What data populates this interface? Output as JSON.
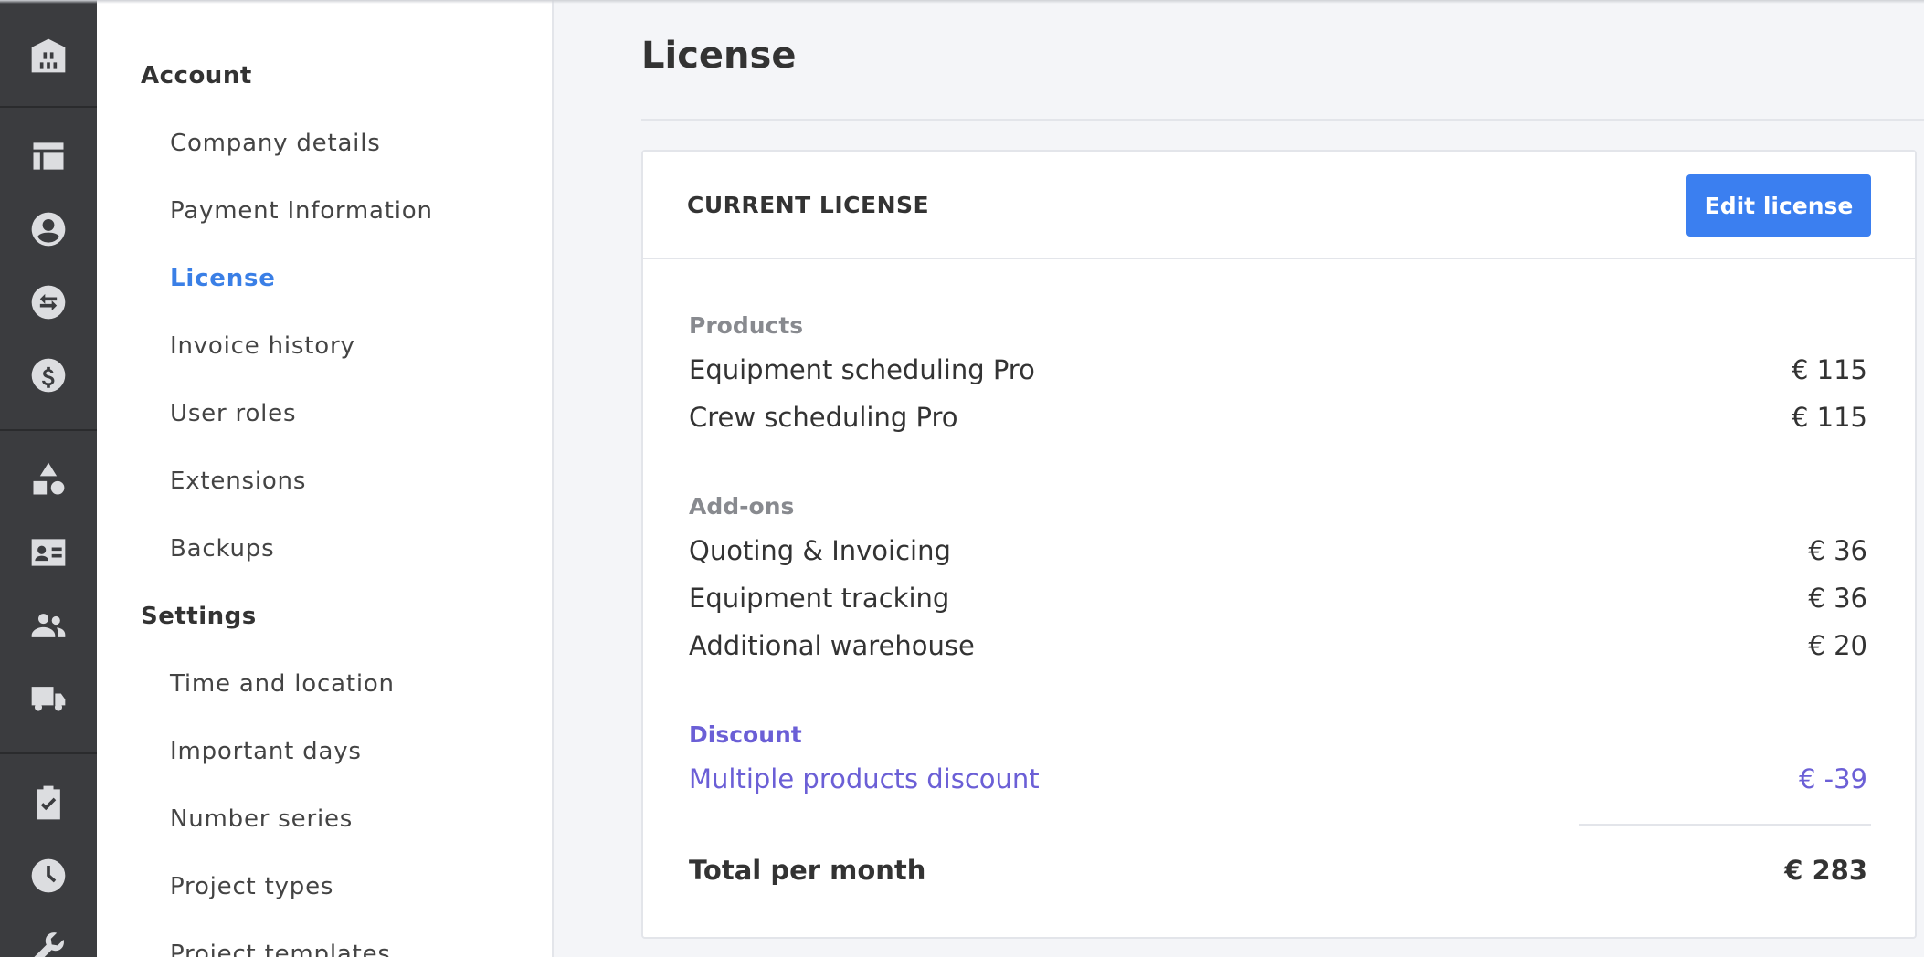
{
  "nav": {
    "groups": [
      {
        "title": "Account",
        "items": [
          "Company details",
          "Payment Information",
          "License",
          "Invoice history",
          "User roles",
          "Extensions",
          "Backups"
        ]
      },
      {
        "title": "Settings",
        "items": [
          "Time and location",
          "Important days",
          "Number series",
          "Project types",
          "Project templates"
        ]
      }
    ],
    "active": "License"
  },
  "rail_icons": [
    "warehouse-icon",
    "planner-icon",
    "contact-icon",
    "transfer-icon",
    "dollar-icon",
    "shapes-icon",
    "contact-card-icon",
    "crew-icon",
    "truck-icon",
    "clipboard-check-icon",
    "clock-icon",
    "wrench-icon"
  ],
  "page": {
    "title": "License"
  },
  "card": {
    "title": "CURRENT LICENSE",
    "edit_label": "Edit license",
    "products": {
      "label": "Products",
      "items": [
        {
          "name": "Equipment scheduling Pro",
          "price": "€ 115"
        },
        {
          "name": "Crew scheduling Pro",
          "price": "€ 115"
        }
      ]
    },
    "addons": {
      "label": "Add-ons",
      "items": [
        {
          "name": "Quoting & Invoicing",
          "price": "€ 36"
        },
        {
          "name": "Equipment tracking",
          "price": "€ 36"
        },
        {
          "name": "Additional warehouse",
          "price": "€ 20"
        }
      ]
    },
    "discount": {
      "label": "Discount",
      "items": [
        {
          "name": "Multiple products discount",
          "price": "€ -39"
        }
      ]
    },
    "total": {
      "label": "Total per month",
      "value": "€ 283"
    }
  },
  "colors": {
    "accent": "#3b7ff0",
    "active_nav": "#3a7fe6",
    "discount": "#6b5fd6",
    "rail": "#3b3c3f"
  }
}
